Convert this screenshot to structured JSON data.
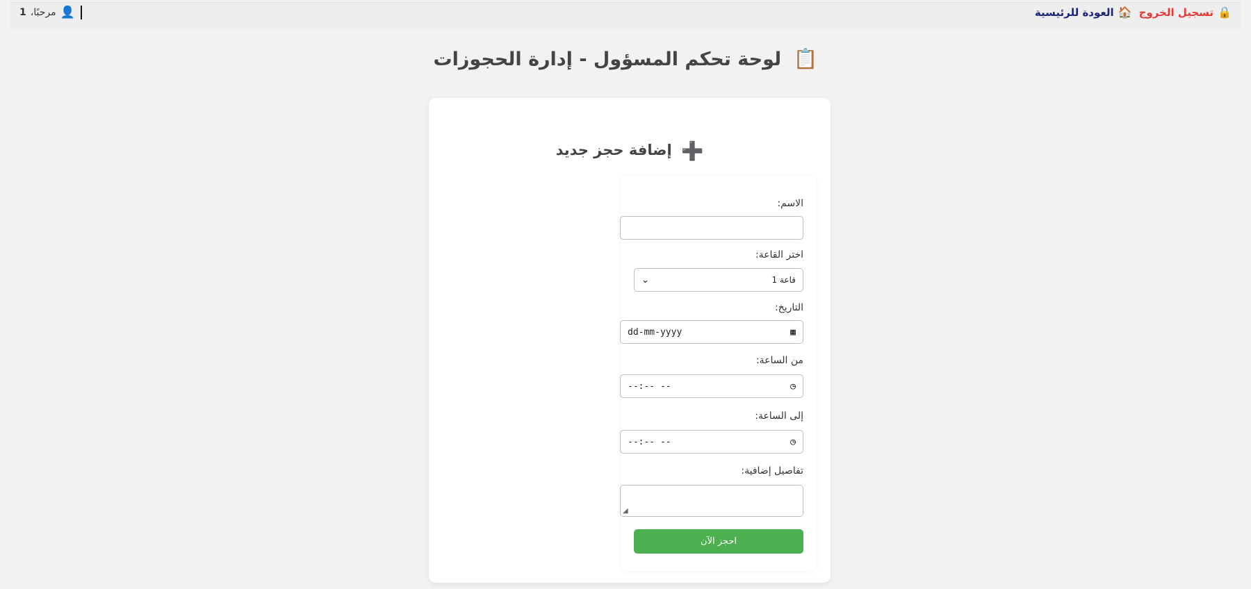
{
  "header": {
    "logout_label": "تسجيل الخروج",
    "logout_icon": "lock-icon",
    "home_label": "العودة للرئيسية",
    "home_icon": "house-icon",
    "welcome_text": "مرحبًا،",
    "username": "1",
    "user_icon": "user-icon"
  },
  "page": {
    "title": "لوحة تحكم المسؤول - إدارة الحجوزات",
    "title_icon": "clipboard-icon"
  },
  "form": {
    "title": "إضافة حجز جديد",
    "title_icon": "plus-icon",
    "name_label": "الاسم:",
    "name_value": "",
    "hall_label": "اختر القاعة:",
    "hall_selected": "قاعة 1",
    "date_label": "التاريخ:",
    "date_placeholder": "dd-mm-yyyy",
    "from_label": "من الساعة:",
    "from_placeholder": "--:-- --",
    "to_label": "إلى الساعة:",
    "to_placeholder": "--:-- --",
    "details_label": "تفاصيل إضافية:",
    "details_value": "",
    "submit_label": "احجز الآن"
  },
  "colors": {
    "logout": "#e53935",
    "home": "#1a237e",
    "submit_bg": "#4caf50",
    "page_bg": "#f2f2f2"
  }
}
